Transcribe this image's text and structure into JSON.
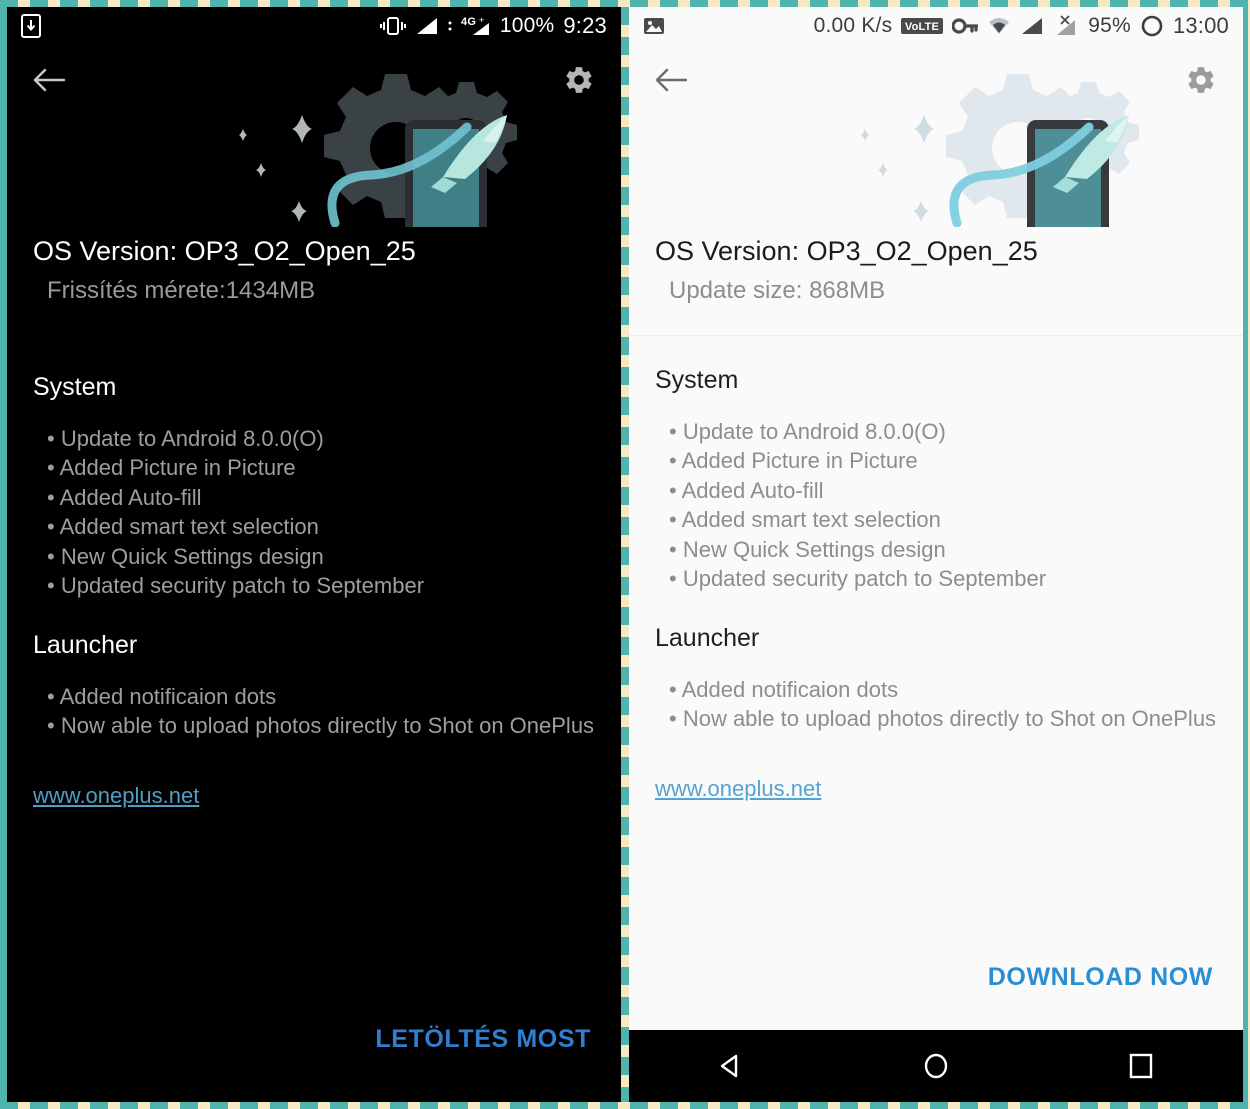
{
  "panels": [
    {
      "theme": "dark",
      "statusbar": {
        "left_icons": [
          "download-indicator-icon"
        ],
        "right_icons": [
          "vibrate-icon",
          "signal-bars-icon",
          "4g-plus-signal-icon"
        ],
        "network_label": "4G",
        "battery": "100%",
        "time": "9:23"
      },
      "appbar": {
        "back_icon": "back-arrow-icon",
        "settings_icon": "gear-icon"
      },
      "header": {
        "os_version": "OS Version: OP3_O2_Open_25",
        "update_size": "Frissítés mérete:1434MB"
      },
      "sections": [
        {
          "title": "System",
          "items": [
            "Update to Android 8.0.0(O)",
            "Added Picture in Picture",
            "Added Auto-fill",
            "Added smart text selection",
            "New Quick Settings design",
            "Updated security patch to September"
          ]
        },
        {
          "title": "Launcher",
          "items": [
            "Added notificaion dots",
            "Now able to upload photos directly to Shot on OnePlus"
          ]
        }
      ],
      "link": "www.oneplus.net",
      "cta": "LETÖLTÉS MOST",
      "has_navbar": false
    },
    {
      "theme": "light",
      "statusbar": {
        "left_icons": [
          "image-icon"
        ],
        "right_icons": [
          "volte-icon",
          "key-vpn-icon",
          "wifi-icon",
          "signal-bars-icon",
          "no-sim-signal-icon",
          "battery-circle-icon"
        ],
        "data_rate": "0.00 K/s",
        "network_label": "VoLTE",
        "battery": "95%",
        "time": "13:00"
      },
      "appbar": {
        "back_icon": "back-arrow-icon",
        "settings_icon": "gear-icon"
      },
      "header": {
        "os_version": "OS Version: OP3_O2_Open_25",
        "update_size": "Update size: 868MB"
      },
      "sections": [
        {
          "title": "System",
          "items": [
            "Update to Android 8.0.0(O)",
            "Added Picture in Picture",
            "Added Auto-fill",
            "Added smart text selection",
            "New Quick Settings design",
            "Updated security patch to September"
          ]
        },
        {
          "title": "Launcher",
          "items": [
            "Added notificaion dots",
            "Now able to upload photos directly to Shot on OnePlus"
          ]
        }
      ],
      "link": "www.oneplus.net",
      "cta": "DOWNLOAD NOW",
      "has_navbar": true,
      "navbar": {
        "back": "nav-back-icon",
        "home": "nav-home-icon",
        "recents": "nav-recents-icon"
      }
    }
  ],
  "colors": {
    "dark_bg": "#000000",
    "light_bg": "#fafafa",
    "accent_link": "#53a3d4",
    "cta_dark": "#2f7fd1",
    "cta_light": "#2b8ed2",
    "teal": "#7ecfd6",
    "frame_teal": "#4fb3ae",
    "frame_cream": "#f7e9c4"
  }
}
